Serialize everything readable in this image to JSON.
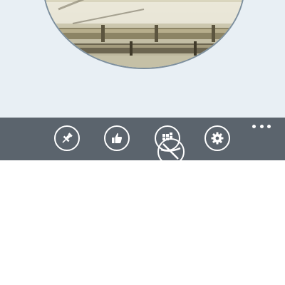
{
  "app_bar": {
    "buttons": [
      {
        "icon": "pin-icon"
      },
      {
        "icon": "thumbs-up-icon"
      },
      {
        "icon": "apps-icon"
      },
      {
        "icon": "gear-icon"
      }
    ],
    "more": {
      "icon": "more-dots-icon"
    }
  },
  "colors": {
    "top_background": "#e8eff4",
    "app_bar": "#5b646d",
    "icon": "#ffffff",
    "bottom_background": "#ffffff"
  }
}
